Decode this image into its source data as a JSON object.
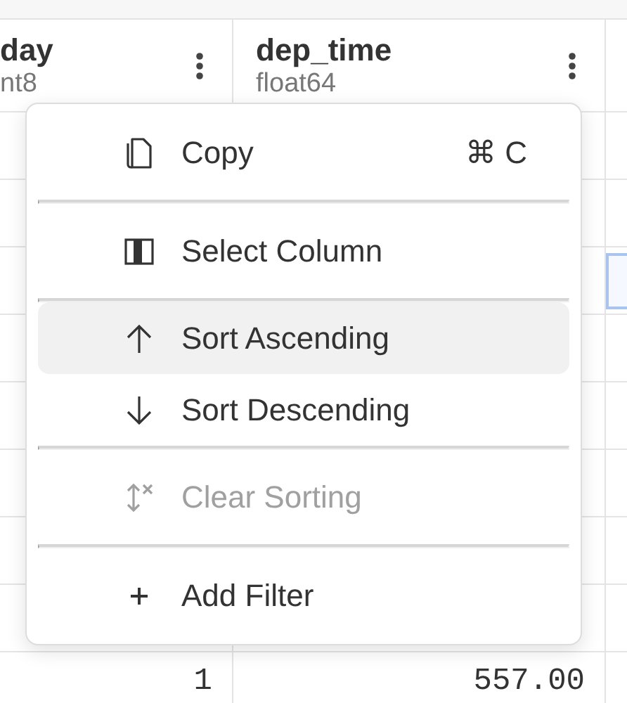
{
  "columns": [
    {
      "name": "day",
      "type": "nt8"
    },
    {
      "name": "dep_time",
      "type": "float64"
    }
  ],
  "rows": [
    {
      "column_3_selected": false
    },
    {
      "column_3_selected": false
    },
    {
      "column_3_selected": true
    },
    {
      "column_3_selected": false
    },
    {
      "column_3_selected": false
    },
    {
      "column_3_selected": false
    },
    {
      "column_3_selected": false
    },
    {
      "column_3_selected": false
    },
    {
      "day": "1",
      "dep_time": "557.00",
      "column_3_selected": false
    }
  ],
  "context_menu": {
    "items": [
      {
        "kind": "copy",
        "label": "Copy",
        "shortcut": "⌘ C",
        "selected": false,
        "disabled": false
      },
      {
        "kind": "separator"
      },
      {
        "kind": "select-column",
        "label": "Select Column",
        "selected": false,
        "disabled": false
      },
      {
        "kind": "separator"
      },
      {
        "kind": "sort-ascending",
        "label": "Sort Ascending",
        "selected": true,
        "disabled": false
      },
      {
        "kind": "sort-descending",
        "label": "Sort Descending",
        "selected": false,
        "disabled": false
      },
      {
        "kind": "separator"
      },
      {
        "kind": "clear-sorting",
        "label": "Clear Sorting",
        "selected": false,
        "disabled": true
      },
      {
        "kind": "separator"
      },
      {
        "kind": "add-filter",
        "label": "Add Filter",
        "selected": false,
        "disabled": false
      }
    ]
  }
}
